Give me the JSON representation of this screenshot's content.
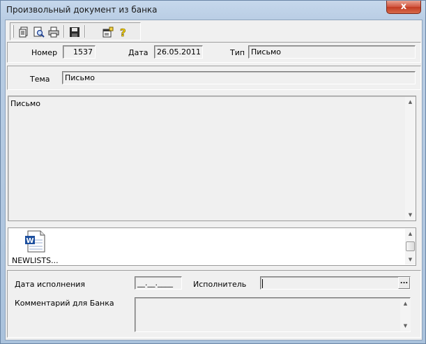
{
  "window": {
    "title": "Произвольный документ из банка",
    "close_glyph": "x"
  },
  "toolbar": {
    "buttons": [
      {
        "name": "new-document-button",
        "icon": "document-icon"
      },
      {
        "name": "preview-button",
        "icon": "magnifier-icon"
      },
      {
        "name": "print-button",
        "icon": "printer-icon"
      },
      {
        "name": "save-button",
        "icon": "floppy-icon"
      },
      {
        "name": "properties-button",
        "icon": "properties-icon"
      },
      {
        "name": "help-button",
        "icon": "question-icon"
      }
    ]
  },
  "header": {
    "number_label": "Номер",
    "number_value": "1537",
    "date_label": "Дата",
    "date_value": "26.05.2011",
    "type_label": "Тип",
    "type_value": "Письмо"
  },
  "subject": {
    "label": "Тема",
    "value": "Письмо"
  },
  "body": {
    "text": "Письмо"
  },
  "attachments": [
    {
      "name": "NEWLISTS...",
      "icon": "word-document-icon"
    }
  ],
  "execution": {
    "date_label": "Дата исполнения",
    "date_value": "__.__.____",
    "executor_label": "Исполнитель",
    "executor_value": "",
    "browse_label": "..."
  },
  "comment": {
    "label": "Комментарий для Банка",
    "value": ""
  },
  "colors": {
    "accent_close": "#c8452d",
    "title_bar": "#bcd0e6"
  }
}
